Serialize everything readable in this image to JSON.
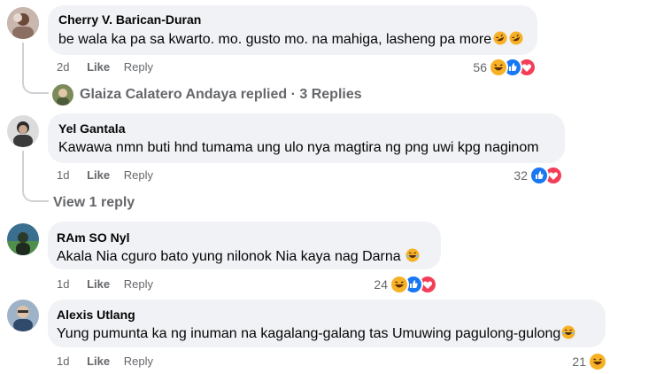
{
  "comments": [
    {
      "author": "Cherry V. Barican-Duran",
      "text": "be wala ka pa sa kwarto. mo. gusto mo. na mahiga, lasheng pa more",
      "time": "2d",
      "like": "Like",
      "reply": "Reply",
      "reaction_count": "56",
      "reactions": [
        "haha-icon",
        "like-icon",
        "love-icon"
      ],
      "text_emojis": [
        "rofl-icon",
        "rofl-icon"
      ],
      "replies_summary": {
        "author": "Glaiza Calatero Andaya",
        "text": "Glaiza Calatero Andaya replied · 3 Replies"
      }
    },
    {
      "author": "Yel Gantala",
      "text": "Kawawa nmn buti hnd tumama ung ulo nya magtira ng png uwi kpg naginom",
      "time": "1d",
      "like": "Like",
      "reply": "Reply",
      "reaction_count": "32",
      "reactions": [
        "like-icon",
        "love-icon"
      ],
      "view_replies": "View 1 reply"
    },
    {
      "author": "RAm SO Nyl",
      "text": "Akala Nia cguro bato yung nilonok Nia kaya nag Darna",
      "time": "1d",
      "like": "Like",
      "reply": "Reply",
      "reaction_count": "24",
      "reactions": [
        "haha-icon",
        "like-icon",
        "love-icon"
      ],
      "text_emojis": [
        "laughing-icon"
      ]
    },
    {
      "author": "Alexis Utlang",
      "text": "Yung pumunta ka ng inuman na kagalang-galang tas Umuwing pagulong-gulong",
      "time": "1d",
      "like": "Like",
      "reply": "Reply",
      "reaction_count": "21",
      "reactions": [
        "haha-icon"
      ],
      "text_emojis": [
        "laughing-icon"
      ]
    }
  ],
  "colors": {
    "bubble": "#f0f2f5",
    "meta": "#65676b",
    "like_blue": "#1877f2",
    "love_red": "#f33e58",
    "haha_yellow": "#f7b125"
  }
}
